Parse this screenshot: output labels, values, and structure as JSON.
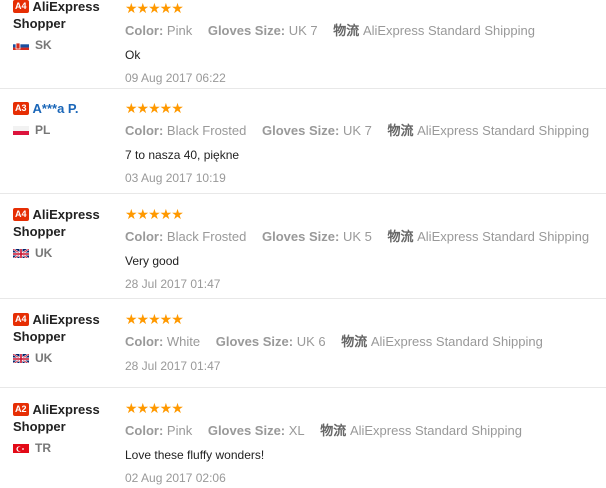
{
  "reviews": [
    {
      "badge": "A4",
      "name": "AliExpress Shopper",
      "country": "SK",
      "flag": "sk",
      "stars": "★★★★★",
      "color_label": "Color:",
      "color": "Pink",
      "size_label": "Gloves Size:",
      "size": "UK 7",
      "ship_label": "物流",
      "shipping": "AliExpress Standard Shipping",
      "text": "Ok",
      "date": "09 Aug 2017 06:22"
    },
    {
      "badge": "A3",
      "name": "A***a P.",
      "country": "PL",
      "flag": "pl",
      "stars": "★★★★★",
      "color_label": "Color:",
      "color": "Black Frosted",
      "size_label": "Gloves Size:",
      "size": "UK 7",
      "ship_label": "物流",
      "shipping": "AliExpress Standard Shipping",
      "text": "7 to nasza 40, piękne",
      "date": "03 Aug 2017 10:19"
    },
    {
      "badge": "A4",
      "name": "AliExpress Shopper",
      "country": "UK",
      "flag": "uk",
      "stars": "★★★★★",
      "color_label": "Color:",
      "color": "Black Frosted",
      "size_label": "Gloves Size:",
      "size": "UK 5",
      "ship_label": "物流",
      "shipping": "AliExpress Standard Shipping",
      "text": "Very good",
      "date": "28 Jul 2017 01:47"
    },
    {
      "badge": "A4",
      "name": "AliExpress Shopper",
      "country": "UK",
      "flag": "uk",
      "stars": "★★★★★",
      "color_label": "Color:",
      "color": "White",
      "size_label": "Gloves Size:",
      "size": "UK 6",
      "ship_label": "物流",
      "shipping": "AliExpress Standard Shipping",
      "text": "",
      "date": "28 Jul 2017 01:47"
    },
    {
      "badge": "A2",
      "name": "AliExpress Shopper",
      "country": "TR",
      "flag": "tr",
      "stars": "★★★★★",
      "color_label": "Color:",
      "color": "Pink",
      "size_label": "Gloves Size:",
      "size": "XL",
      "ship_label": "物流",
      "shipping": "AliExpress Standard Shipping",
      "text": "Love these fluffy wonders!",
      "date": "02 Aug 2017 02:06"
    }
  ],
  "colors": {
    "star": "#ff9900",
    "badge": "#e62e04",
    "name_blue": "#1a66b8"
  }
}
